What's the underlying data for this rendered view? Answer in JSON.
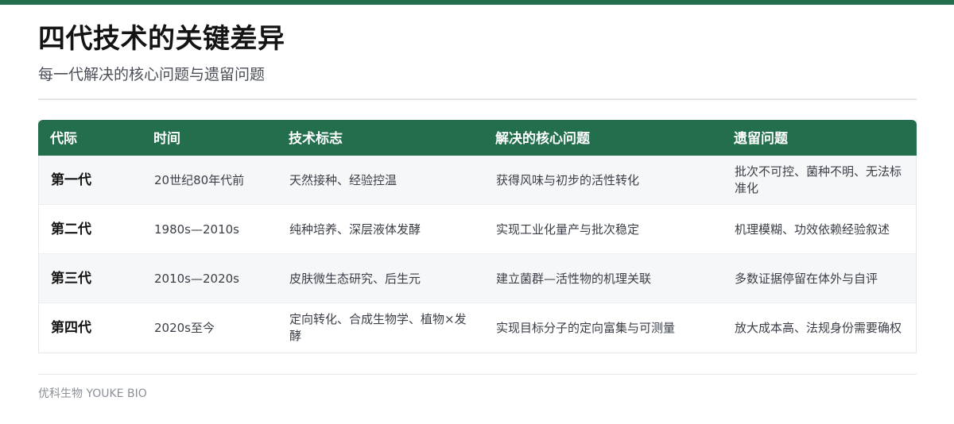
{
  "page": {
    "title": "四代技术的关键差异",
    "subtitle": "每一代解决的核心问题与遗留问题"
  },
  "table": {
    "headers": [
      "代际",
      "时间",
      "技术标志",
      "解决的核心问题",
      "遗留问题"
    ],
    "rows": [
      [
        "第一代",
        "20世纪80年代前",
        "天然接种、经验控温",
        "获得风味与初步的活性转化",
        "批次不可控、菌种不明、无法标准化"
      ],
      [
        "第二代",
        "1980s—2010s",
        "纯种培养、深层液体发酵",
        "实现工业化量产与批次稳定",
        "机理模糊、功效依赖经验叙述"
      ],
      [
        "第三代",
        "2010s—2020s",
        "皮肤微生态研究、后生元",
        "建立菌群—活性物的机理关联",
        "多数证据停留在体外与自评"
      ],
      [
        "第四代",
        "2020s至今",
        "定向转化、合成生物学、植物×发酵",
        "实现目标分子的定向富集与可测量",
        "放大成本高、法规身份需要确权"
      ]
    ]
  },
  "footer": {
    "brand": "优科生物 YOUKE BIO"
  },
  "colors": {
    "accent": "#236f4d",
    "row_alt": "#f6f7f9"
  }
}
